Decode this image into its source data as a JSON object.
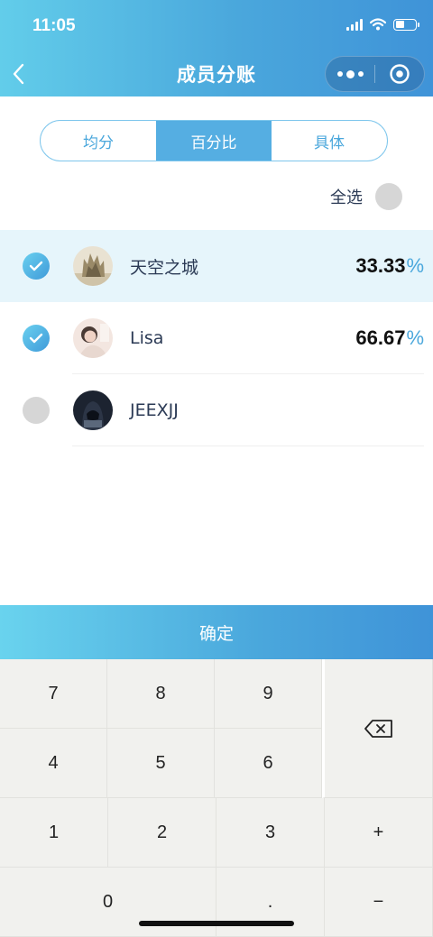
{
  "status_bar": {
    "time": "11:05"
  },
  "nav": {
    "title": "成员分账"
  },
  "tabs": [
    {
      "label": "均分",
      "active": false
    },
    {
      "label": "百分比",
      "active": true
    },
    {
      "label": "具体",
      "active": false
    }
  ],
  "select_all": {
    "label": "全选",
    "checked": false
  },
  "members": [
    {
      "name": "天空之城",
      "checked": true,
      "percent": "33.33",
      "percent_symbol": "%"
    },
    {
      "name": "Lisa",
      "checked": true,
      "percent": "66.67",
      "percent_symbol": "%"
    },
    {
      "name": "JEEXJJ",
      "checked": false,
      "percent": "",
      "percent_symbol": ""
    }
  ],
  "confirm_label": "确定",
  "keypad": {
    "k7": "7",
    "k8": "8",
    "k9": "9",
    "k4": "4",
    "k5": "5",
    "k6": "6",
    "k1": "1",
    "k2": "2",
    "k3": "3",
    "k0": "0",
    "dot": ".",
    "plus": "+",
    "minus": "−",
    "backspace_icon": "backspace-icon"
  },
  "colors": {
    "accent": "#4aa7dc",
    "accent_light": "#62cdea",
    "highlight_row": "#e6f5fb",
    "keypad_bg": "#f1f1ee"
  }
}
